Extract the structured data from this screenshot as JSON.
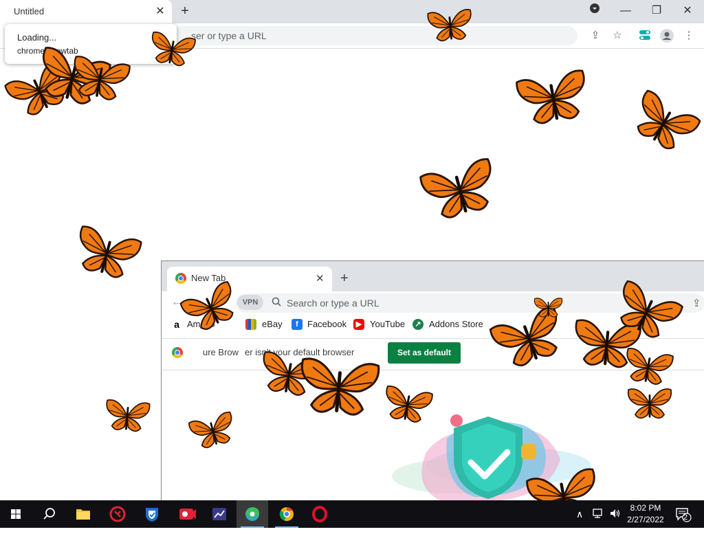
{
  "main_window": {
    "tab_title": "Untitled",
    "omnibox_text": "ser or type a URL",
    "tooltip": {
      "line1": "Loading...",
      "line2": "chrome://newtab"
    }
  },
  "second_window": {
    "tab_title": "New Tab",
    "vpn_label": "VPN",
    "omnibox_placeholder": "Search or type a URL",
    "bookmarks": [
      {
        "label": "Amazo",
        "icon": "amazon-icon"
      },
      {
        "label": "eBay",
        "icon": "ebay-icon"
      },
      {
        "label": "Facebook",
        "icon": "facebook-icon"
      },
      {
        "label": "YouTube",
        "icon": "youtube-icon"
      },
      {
        "label": "Addons Store",
        "icon": "addons-store-icon"
      }
    ],
    "infobar": {
      "text_a": "ure Brow",
      "text_b": "er isn't your default browser",
      "button": "Set as default"
    }
  },
  "taskbar": {
    "apps": [
      {
        "name": "search",
        "icon": "search-icon"
      },
      {
        "name": "file-explorer",
        "icon": "folder-icon"
      },
      {
        "name": "app-red",
        "icon": "shield-red-icon"
      },
      {
        "name": "app-shield",
        "icon": "shield-blue-icon"
      },
      {
        "name": "app-recorder",
        "icon": "recorder-icon"
      },
      {
        "name": "app-chart",
        "icon": "chart-app-icon"
      },
      {
        "name": "edge",
        "icon": "edge-icon"
      },
      {
        "name": "browser",
        "icon": "chrome-like-icon"
      },
      {
        "name": "opera",
        "icon": "opera-icon"
      }
    ],
    "time": "8:02 PM",
    "date": "2/27/2022",
    "notification_count": "2"
  },
  "colors": {
    "butterfly_orange": "#f07a12",
    "set_default_green": "#0b8043",
    "taskbar": "#101014"
  }
}
